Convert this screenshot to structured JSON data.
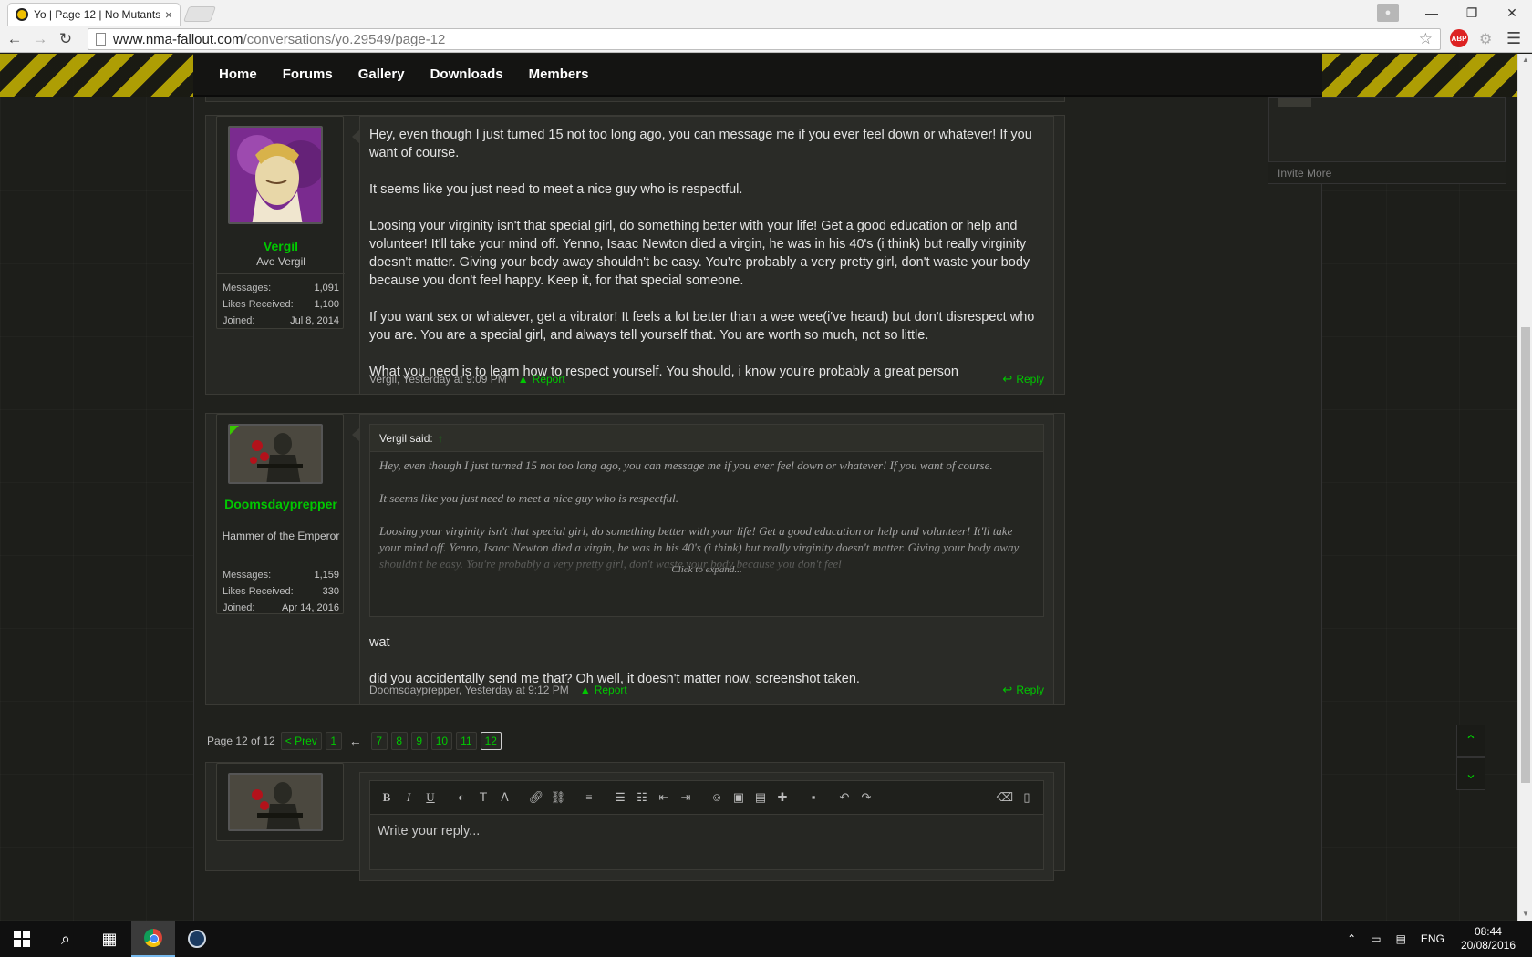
{
  "browser": {
    "tab_title": "Yo | Page 12 | No Mutants",
    "tab_close": "×",
    "url_host": "www.nma-fallout.com",
    "url_path": "/conversations/yo.29549/page-12",
    "abp_label": "ABP"
  },
  "window_controls": {
    "minimize": "—",
    "restore": "❐",
    "close": "✕"
  },
  "site_nav": {
    "items": [
      "Home",
      "Forums",
      "Gallery",
      "Downloads",
      "Members"
    ]
  },
  "sidebar": {
    "invite_more": "Invite More"
  },
  "posts": [
    {
      "username": "Vergil",
      "user_title": "Ave Vergil",
      "stats": [
        {
          "label": "Messages:",
          "value": "1,091"
        },
        {
          "label": "Likes Received:",
          "value": "1,100"
        },
        {
          "label": "Joined:",
          "value": "Jul 8, 2014"
        }
      ],
      "paragraphs": [
        "Hey, even though I just turned 15 not too long ago, you can message me if you ever feel down or whatever! If you want of course.",
        "It seems like you just need to meet a nice guy who is respectful.",
        "Loosing your virginity isn't that special girl, do something better with your life! Get a good education or help and volunteer! It'll take your mind off. Yenno, Isaac Newton died a virgin, he was in his 40's (i think) but really virginity doesn't matter. Giving your body away shouldn't be easy. You're probably a very pretty girl, don't waste your body because you don't feel happy. Keep it, for that special someone.",
        "If you want sex or whatever, get a vibrator! It feels a lot better than a wee wee(i've heard) but don't disrespect who you are. You are a special girl, and always tell yourself that. You are worth so much, not so little.",
        "What you need is to learn how to respect yourself. You should, i know you're probably a great person"
      ],
      "footer_meta": "Vergil, Yesterday at 9:09 PM",
      "report": "Report",
      "reply": "Reply"
    },
    {
      "username": "Doomsdayprepper",
      "user_title": "Hammer of the Emperor",
      "stats": [
        {
          "label": "Messages:",
          "value": "1,159"
        },
        {
          "label": "Likes Received:",
          "value": "330"
        },
        {
          "label": "Joined:",
          "value": "Apr 14, 2016"
        }
      ],
      "quote": {
        "author": "Vergil said:",
        "arrow": "↑",
        "paragraphs": [
          "Hey, even though I just turned 15 not too long ago, you can message me if you ever feel down or whatever! If you want of course.",
          "It seems like you just need to meet a nice guy who is respectful.",
          "Loosing your virginity isn't that special girl, do something better with your life! Get a good education or help and volunteer! It'll take your mind off. Yenno, Isaac Newton died a virgin, he was in his 40's (i think) but really virginity doesn't matter. Giving your body away shouldn't be easy. You're probably a very pretty girl, don't waste your body because you don't feel"
        ],
        "expand": "Click to expand..."
      },
      "paragraphs": [
        "wat",
        "did you accidentally send me that? Oh well, it doesn't matter now, screenshot taken."
      ],
      "footer_meta": "Doomsdayprepper, Yesterday at 9:12 PM",
      "report": "Report",
      "reply": "Reply"
    }
  ],
  "pagination": {
    "label": "Page 12 of 12",
    "prev": "< Prev",
    "first": "1",
    "arrow": "←",
    "pages": [
      "7",
      "8",
      "9",
      "10",
      "11"
    ],
    "current": "12"
  },
  "editor": {
    "placeholder": "Write your reply...",
    "toolbar": [
      "B",
      "I",
      "U"
    ]
  },
  "taskbar": {
    "language": "ENG",
    "time": "08:44",
    "date": "20/08/2016"
  },
  "colors": {
    "accent": "#00c800",
    "background": "#1c1d19",
    "panel": "#272824"
  }
}
